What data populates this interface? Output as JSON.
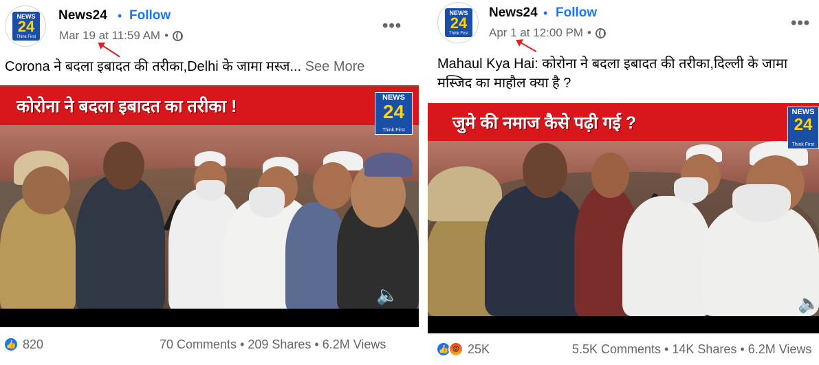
{
  "left_post": {
    "page_name": "News24",
    "separator": "•",
    "follow_label": "Follow",
    "timestamp": "Mar 19 at 11:59 AM",
    "meta_separator": "•",
    "avatar_logo": {
      "top": "NEWS",
      "num": "24",
      "tag": "Think First"
    },
    "caption": "Corona ने बदला इबादत की तरीका,Delhi के जामा मस्ज...",
    "see_more": "See More",
    "video": {
      "banner_text": "कोरोना ने बदला इबादत का तरीका !",
      "logo": {
        "top": "NEWS",
        "num": "24",
        "tag": "Think First"
      },
      "sound_icon": "speaker-icon"
    },
    "reaction_count": "820",
    "stats": "70 Comments • 209 Shares • 6.2M Views"
  },
  "right_post": {
    "page_name": "News24",
    "separator": "•",
    "follow_label": "Follow",
    "timestamp": "Apr 1 at 12:00 PM",
    "meta_separator": "•",
    "avatar_logo": {
      "top": "NEWS",
      "num": "24",
      "tag": "Think First"
    },
    "caption_line1": "Mahaul Kya Hai: कोरोना ने बदला इबादत की तरीका,दिल्ली के जामा",
    "caption_line2": "मस्जिद का माहौल क्या है ?",
    "video": {
      "banner_text": "जुमे की नमाज कैसे पढ़ी गई ?",
      "logo": {
        "top": "NEWS",
        "num": "24",
        "tag": "Think First"
      },
      "sound_icon": "speaker-icon"
    },
    "reaction_count": "25K",
    "stats": "5.5K Comments • 14K Shares • 6.2M Views"
  },
  "icons": {
    "more": "•••",
    "like": "👍",
    "angry": "😡",
    "speaker": "🔈"
  },
  "colors": {
    "facebook_blue": "#1877f2",
    "meta_gray": "#65676b",
    "banner_red": "#d8171c",
    "annotation_arrow": "#e0201e"
  }
}
